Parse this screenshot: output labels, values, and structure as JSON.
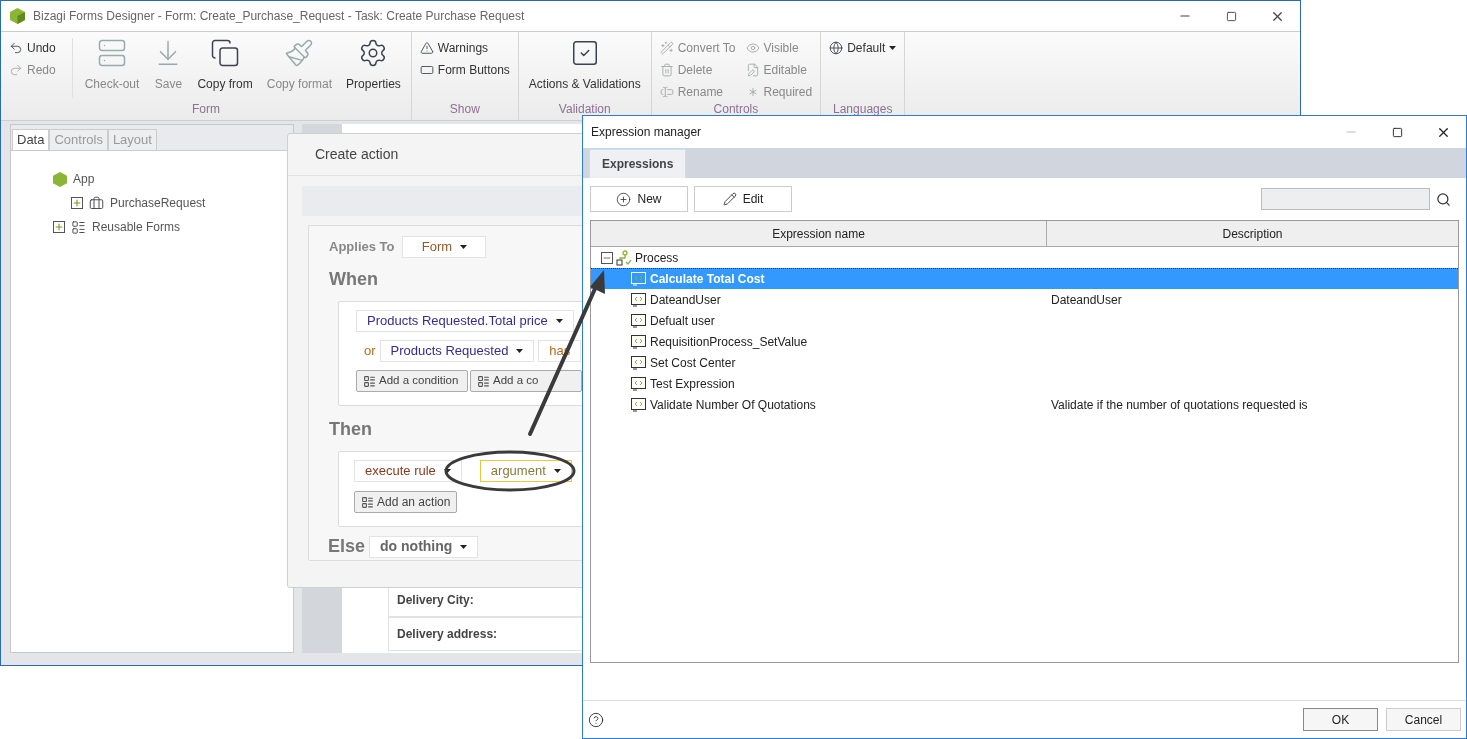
{
  "main_window": {
    "title": "Bizagi Forms Designer  - Form: Create_Purchase_Request - Task:  Create Purchase Request"
  },
  "ribbon": [
    {
      "label": "Form",
      "columns": [
        {
          "kind": "stack",
          "items": [
            {
              "label": "Undo",
              "kind": "button",
              "disabled": false
            },
            {
              "label": "Redo",
              "kind": "button",
              "disabled": true
            }
          ]
        },
        {
          "kind": "large",
          "label": "Check-out",
          "disabled": true
        },
        {
          "kind": "large",
          "label": "Save",
          "disabled": true
        },
        {
          "kind": "large",
          "label": "Copy from",
          "disabled": false
        },
        {
          "kind": "large",
          "label": "Copy format",
          "disabled": true
        },
        {
          "kind": "large",
          "label": "Properties",
          "disabled": false
        }
      ]
    },
    {
      "label": "Show",
      "columns": [
        {
          "kind": "stack",
          "items": [
            {
              "label": "Warnings",
              "kind": "button",
              "disabled": false
            },
            {
              "label": "Form Buttons",
              "kind": "button",
              "disabled": false
            }
          ]
        }
      ]
    },
    {
      "label": "Validation",
      "columns": [
        {
          "kind": "large",
          "label": "Actions & Validations",
          "disabled": false
        }
      ]
    },
    {
      "label": "Controls",
      "columns": [
        {
          "kind": "stack",
          "items": [
            {
              "label": "Convert To",
              "kind": "button",
              "disabled": true
            },
            {
              "label": "Delete",
              "kind": "button",
              "disabled": true
            },
            {
              "label": "Rename",
              "kind": "button",
              "disabled": true
            }
          ]
        },
        {
          "kind": "stack",
          "items": [
            {
              "label": "Visible",
              "kind": "button",
              "disabled": true
            },
            {
              "label": "Editable",
              "kind": "button",
              "disabled": true
            },
            {
              "label": "Required",
              "kind": "button",
              "disabled": true
            }
          ]
        }
      ]
    },
    {
      "label": "Languages",
      "columns": [
        {
          "kind": "stack",
          "items": [
            {
              "label": "Default",
              "kind": "dropdown",
              "disabled": false
            }
          ]
        }
      ]
    }
  ],
  "left_panel": {
    "tabs": [
      {
        "label": "Data",
        "selected": true
      },
      {
        "label": "Controls",
        "selected": false
      },
      {
        "label": "Layout",
        "selected": false
      }
    ],
    "tree": [
      {
        "label": "App",
        "children": [
          {
            "label": "PurchaseRequest",
            "expanded": false
          }
        ]
      },
      {
        "label": "Reusable Forms",
        "expanded": false
      }
    ]
  },
  "form_fields": [
    {
      "label": "Delivery City:"
    },
    {
      "label": "Delivery address:"
    }
  ],
  "create_action": {
    "title": "Create action",
    "applies_to": {
      "label": "Applies To",
      "value": "Form"
    },
    "when": {
      "heading": "When",
      "conditions": [
        {
          "field": "Products Requested.Total price"
        },
        {
          "prefix": "or",
          "field": "Products Requested",
          "operator": "has"
        }
      ],
      "buttons": [
        "Add a condition",
        "Add a co"
      ]
    },
    "then": {
      "heading": "Then",
      "action": {
        "verb": "execute rule",
        "argument": "argument",
        "highlighted": true
      },
      "button": "Add an action"
    },
    "else": {
      "heading": "Else",
      "value": "do nothing"
    }
  },
  "expression_manager": {
    "title": "Expression manager",
    "tabs": [
      {
        "label": "Expressions",
        "selected": true
      }
    ],
    "buttons": [
      "New",
      "Edit"
    ],
    "columns": [
      "Expression name",
      "Description"
    ],
    "tree": {
      "label": "Process",
      "expanded": true,
      "rows": [
        {
          "name": "Calculate Total Cost",
          "selected": true
        },
        {
          "name": "DateandUser",
          "description": "DateandUser",
          "selected": false
        },
        {
          "name": "Defualt user",
          "selected": false
        },
        {
          "name": "RequisitionProcess_SetValue",
          "selected": false
        },
        {
          "name": "Set Cost Center",
          "selected": false
        },
        {
          "name": "Test Expression",
          "selected": false
        },
        {
          "name": "Validate Number Of Quotations",
          "description": "Validate if the number of quotations requested is",
          "selected": false
        }
      ]
    },
    "footer_buttons": [
      "OK",
      "Cancel"
    ]
  }
}
